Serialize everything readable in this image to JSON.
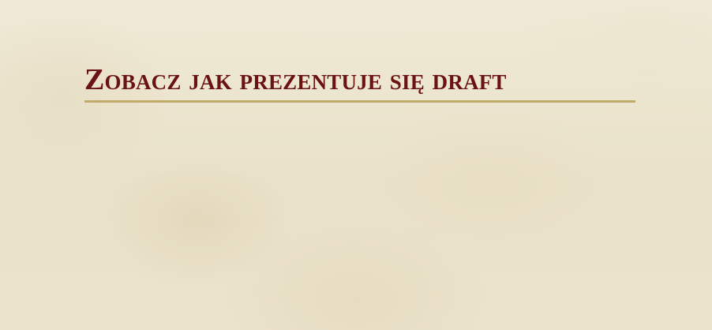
{
  "section": {
    "title": "Zobacz jak prezentuje się draft"
  },
  "colors": {
    "title_text": "#6b1212",
    "underline": "#c2aa6a",
    "background": "#ede6d0"
  }
}
